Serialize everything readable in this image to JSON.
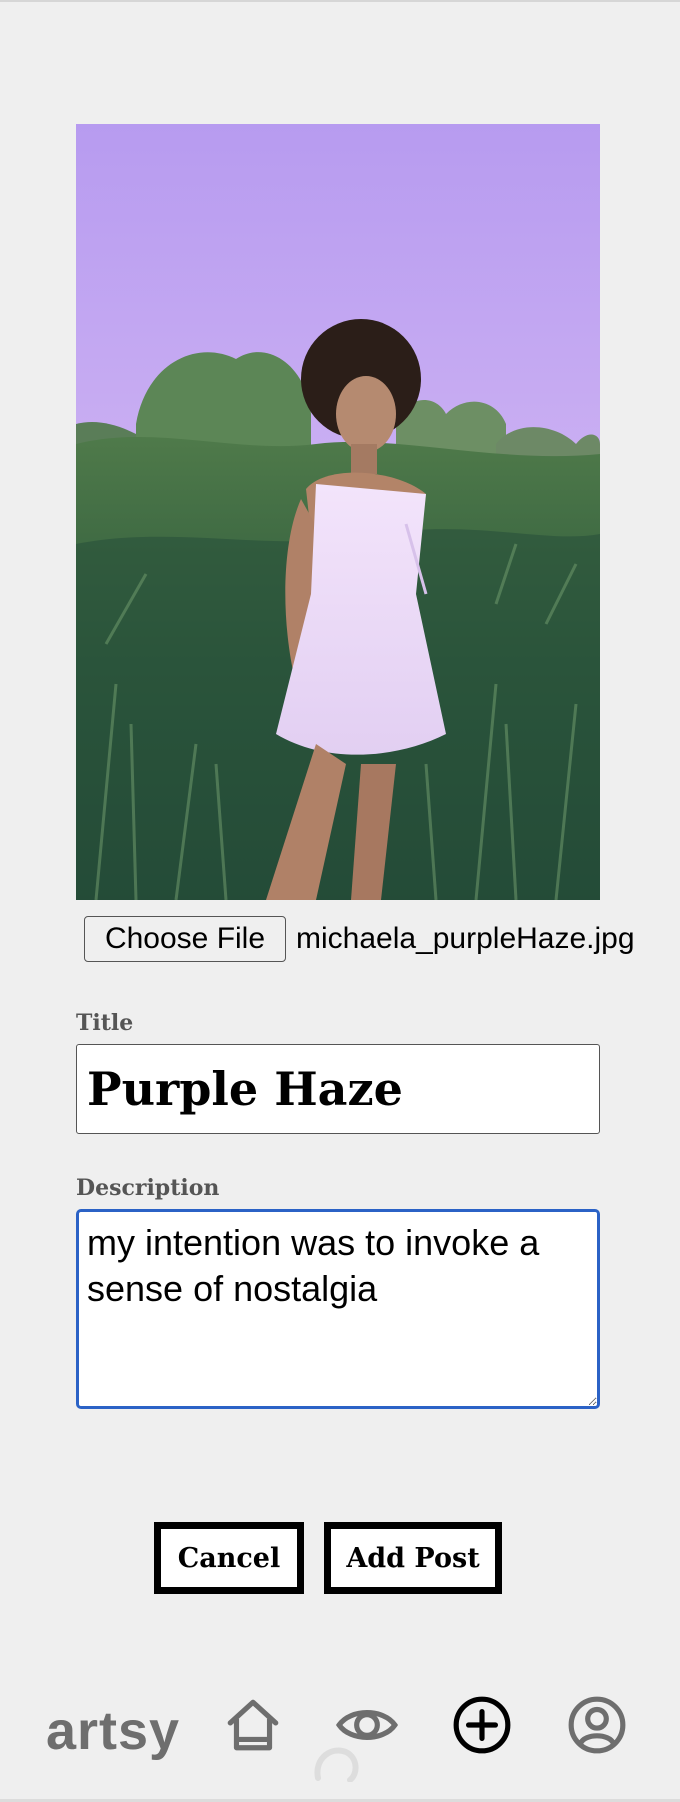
{
  "photo": {
    "alt": "Woman in a white dress standing in tall green brush under a purple sky"
  },
  "file_chooser": {
    "button_label": "Choose File",
    "file_name": "michaela_purpleHaze.jpg"
  },
  "title_field": {
    "label": "Title",
    "value": "Purple Haze"
  },
  "description_field": {
    "label": "Description",
    "value": "my intention was to invoke a sense of nostalgia"
  },
  "actions": {
    "cancel_label": "Cancel",
    "add_post_label": "Add Post"
  },
  "bottom_nav": {
    "logo": "artsy",
    "icons": [
      "home-icon",
      "eye-icon",
      "plus-circle-icon",
      "profile-icon"
    ]
  },
  "colors": {
    "focus_border": "#2b62c6",
    "nav_icon": "#6e6e6e",
    "active_nav_icon": "#000000",
    "background": "#efefef"
  }
}
